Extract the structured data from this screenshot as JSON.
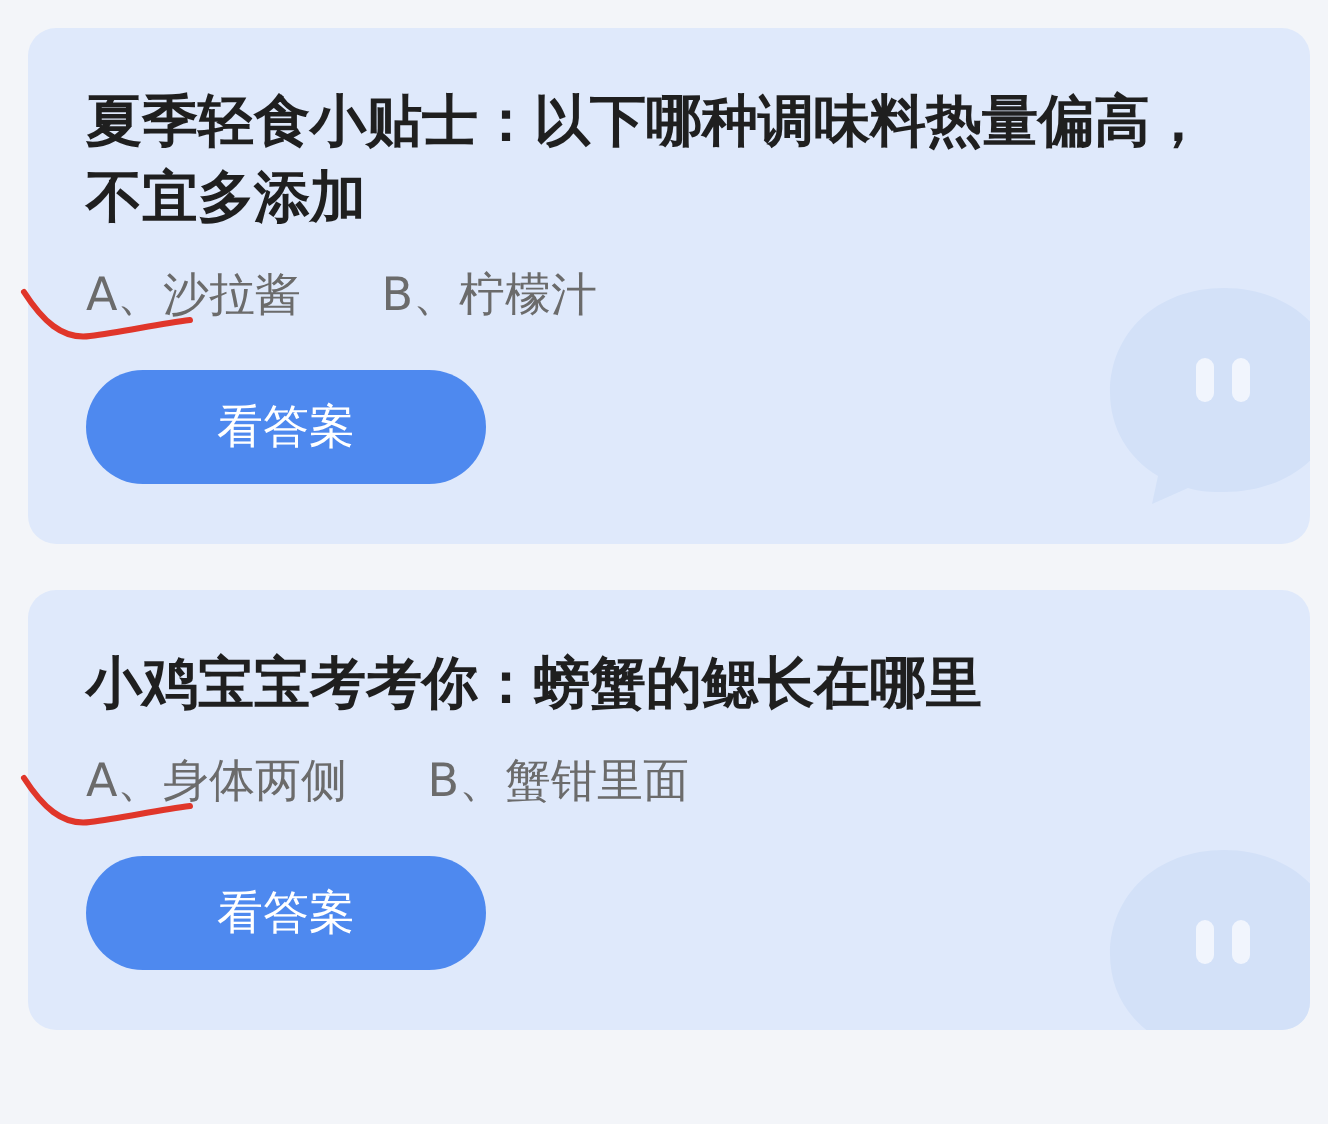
{
  "cards": [
    {
      "question": "夏季轻食小贴士：以下哪种调味料热量偏高，不宜多添加",
      "options": [
        {
          "text": "A、沙拉酱",
          "marked": true
        },
        {
          "text": "B、柠檬汁",
          "marked": false
        }
      ],
      "button": "看答案"
    },
    {
      "question": "小鸡宝宝考考你：螃蟹的鳃长在哪里",
      "options": [
        {
          "text": "A、身体两侧",
          "marked": true
        },
        {
          "text": "B、蟹钳里面",
          "marked": false
        }
      ],
      "button": "看答案"
    }
  ]
}
